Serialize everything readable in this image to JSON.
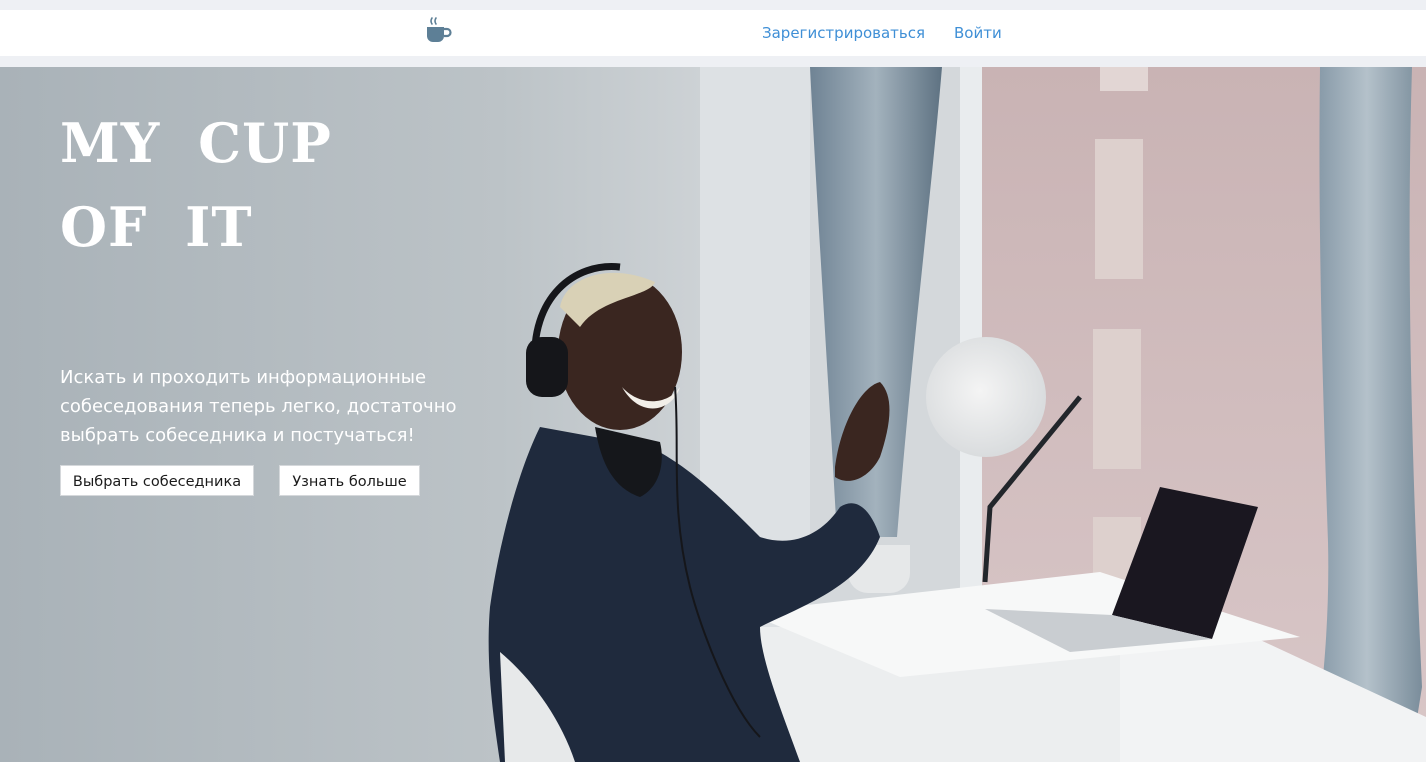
{
  "nav": {
    "logo_icon": "coffee-cup-icon",
    "register_label": "Зарегистрироваться",
    "login_label": "Войти"
  },
  "hero": {
    "title_line1": "MY CUP",
    "title_line2": "OF IT",
    "subtitle": "Искать и проходить информационные собеседования теперь легко, достаточно выбрать собеседника и постучаться!",
    "choose_button": "Выбрать собеседника",
    "learn_more_button": "Узнать больше"
  },
  "colors": {
    "nav_link": "#3f8fd6",
    "logo": "#5d7f96",
    "hero_text": "#ffffff"
  }
}
